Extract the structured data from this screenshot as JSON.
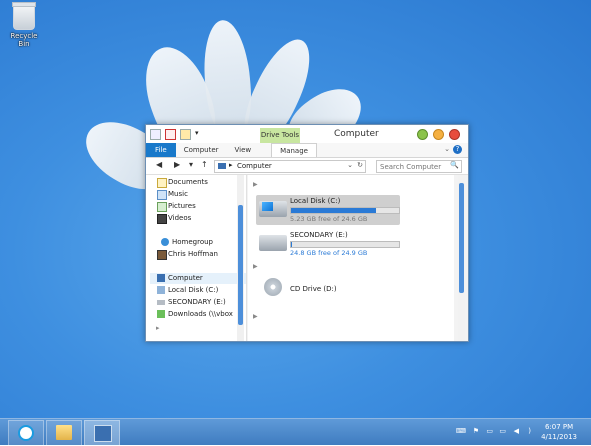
{
  "desktop": {
    "recycle_bin_label": "Recycle Bin"
  },
  "window": {
    "title": "Computer",
    "contextual_tab_group": "Drive Tools",
    "ribbon_tabs": [
      "File",
      "Computer",
      "View",
      "Manage"
    ],
    "help_label": "?"
  },
  "addressbar": {
    "back": "◀",
    "forward": "▶",
    "recent": "▾",
    "up": "↑",
    "path": "Computer",
    "path_arrow": "▸",
    "dropdown": "⌄",
    "refresh": "↻"
  },
  "search": {
    "placeholder": "Search Computer",
    "icon": "🔍"
  },
  "navpane": {
    "items": [
      {
        "label": "Documents",
        "icon": "documents-icon"
      },
      {
        "label": "Music",
        "icon": "music-icon"
      },
      {
        "label": "Pictures",
        "icon": "pictures-icon"
      },
      {
        "label": "Videos",
        "icon": "videos-icon"
      },
      {
        "label": "Homegroup",
        "icon": "homegroup-icon"
      },
      {
        "label": "Chris Hoffman",
        "icon": "user-icon"
      },
      {
        "label": "Computer",
        "icon": "computer-icon"
      },
      {
        "label": "Local Disk (C:)",
        "icon": "local-disk-icon"
      },
      {
        "label": "SECONDARY (E:)",
        "icon": "drive-icon"
      },
      {
        "label": "Downloads (\\\\vbox",
        "icon": "network-drive-icon"
      }
    ]
  },
  "drives": [
    {
      "name": "Local Disk (C:)",
      "free": "5.23 GB free of 24.6 GB",
      "used_fraction": 0.79
    },
    {
      "name": "SECONDARY (E:)",
      "free": "24.8 GB free of 24.9 GB",
      "used_fraction": 0.004
    },
    {
      "name": "CD Drive (D:)"
    }
  ],
  "taskbar": {
    "time": "6:07 PM",
    "date": "4/11/2013"
  },
  "colors": {
    "accent": "#1979ca",
    "contextual_tab": "#c8e6a0",
    "progress": "#2a7ad6"
  }
}
